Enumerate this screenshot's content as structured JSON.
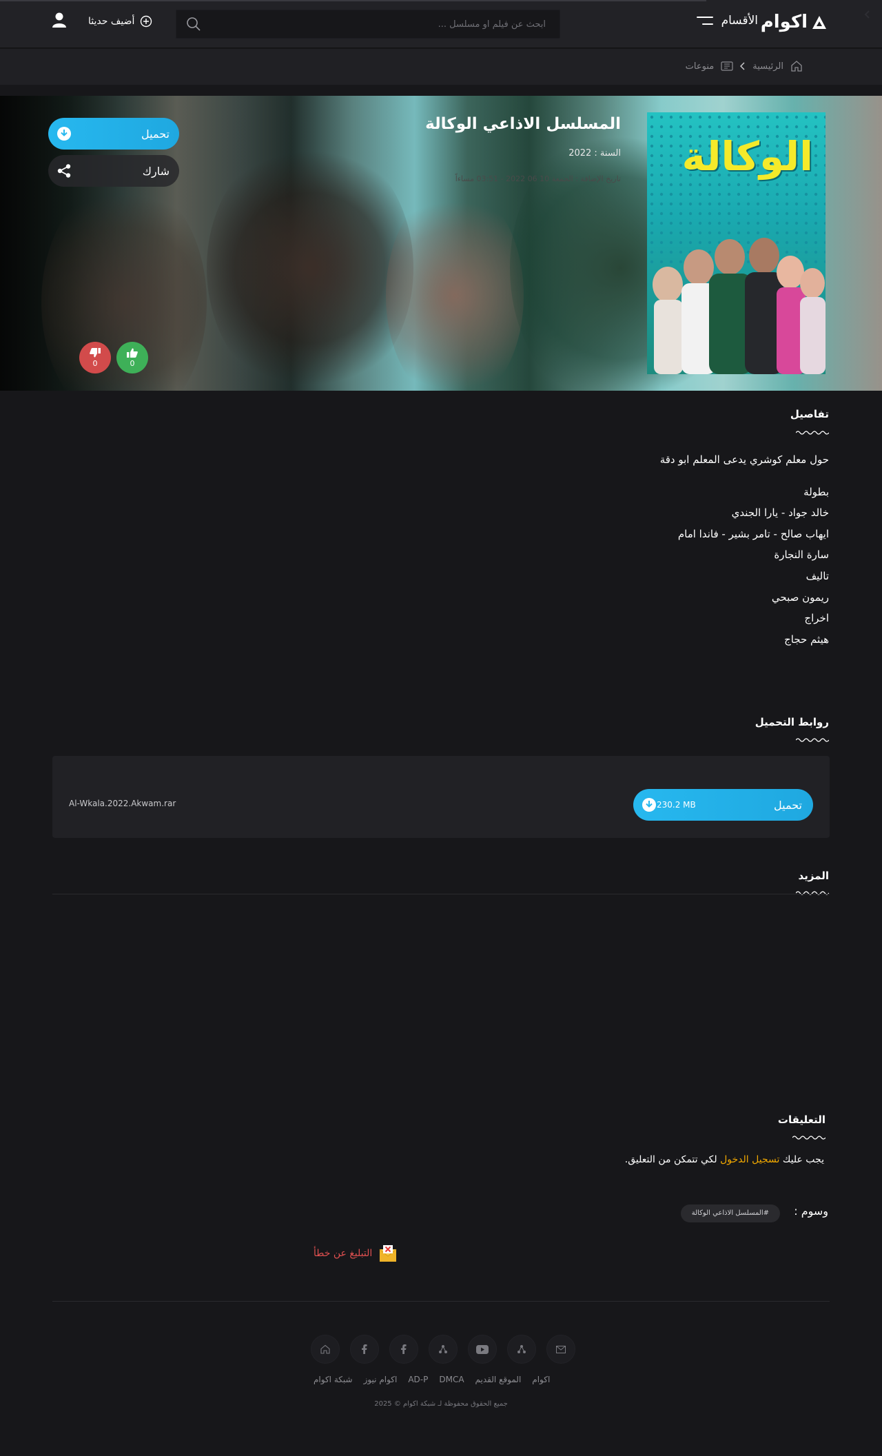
{
  "header": {
    "logo_text": "اكوام",
    "menu_label": "الأقسام",
    "search_placeholder": "ابحث عن فيلم او مسلسل ...",
    "added_recently": "أضيف حديثا"
  },
  "breadcrumb": {
    "home": "الرئيسية",
    "category": "منوعات"
  },
  "hero": {
    "title": "المسلسل الاذاعي الوكالة",
    "year": "السنة : 2022",
    "added_date": "تاريخ الإضافة : الجمعة 10 06 2022 - 03:51 مساءاً",
    "poster_title": "الوكالة",
    "download_label": "تحميل",
    "share_label": "شارك",
    "likes": "0",
    "dislikes": "0"
  },
  "details": {
    "heading": "تفاصيل",
    "description": "حول معلم كوشري يدعى المعلم ابو دقة",
    "lines": [
      "بطولة",
      "خالد جواد - يارا الجندي",
      "ايهاب صالح -  تامر بشير - فاندا امام",
      "سارة النجارة",
      "تاليف",
      "ريمون صبحي",
      "اخراج",
      "هيثم حجاج"
    ]
  },
  "downloads": {
    "heading": "روابط التحميل",
    "button_label": "تحميل",
    "size": "230.2 MB",
    "filename": "Al-Wkala.2022.Akwam.rar"
  },
  "more": {
    "heading": "المزيد"
  },
  "comments": {
    "heading": "التعليقات",
    "text_before": "يجب عليك",
    "login_link": "تسجيل الدخول",
    "text_after": "لكي تتمكن من التعليق."
  },
  "tags": {
    "label": "وسوم :",
    "items": [
      "#المسلسل الاذاعي الوكالة"
    ]
  },
  "report": {
    "label": "التبليغ عن خطأ"
  },
  "footer": {
    "links": [
      "اكوام",
      "الموقع القديم",
      "DMCA",
      "AD-P",
      "اكوام نيوز",
      "شبكة اكوام"
    ],
    "copyright": "جميع الحقوق محفوظة لـ شبكة اكوام © 2025"
  },
  "colors": {
    "background": "#17171a",
    "accent_blue": "#27b8ef",
    "like_green": "#3eb058",
    "dislike_red": "#d24b4b",
    "link_orange": "#f2a900",
    "report_red": "#e05050"
  }
}
